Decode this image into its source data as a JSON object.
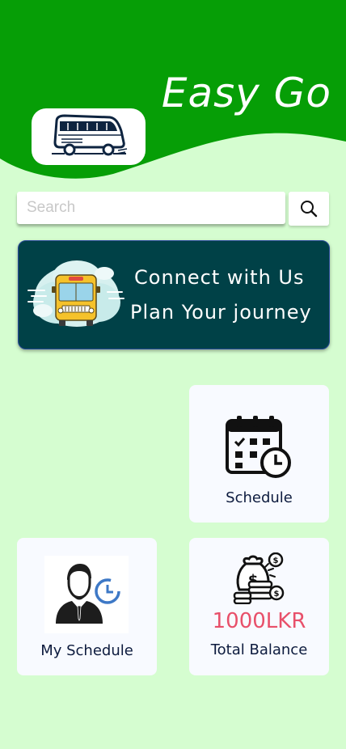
{
  "app": {
    "title": "Easy Go"
  },
  "search": {
    "placeholder": "Search"
  },
  "banner": {
    "line1": "Connect with Us",
    "line2": "Plan Your journey"
  },
  "cards": {
    "schedule": {
      "label": "Schedule",
      "icon": "calendar-clock-icon"
    },
    "my_schedule": {
      "label": "My Schedule",
      "icon": "user-clock-icon"
    },
    "balance": {
      "amount": "1000LKR",
      "label": "Total Balance",
      "icon": "money-bags-icon"
    }
  },
  "colors": {
    "header_green": "#069e06",
    "background": "#d5fdd0",
    "banner_bg": "#004147",
    "card_bg": "#f8faff",
    "balance_red": "#e8506a",
    "label_navy": "#0d1b3e"
  },
  "icons": {
    "logo": "bus-logo-icon",
    "search": "search-icon",
    "banner": "bus-clouds-icon"
  }
}
